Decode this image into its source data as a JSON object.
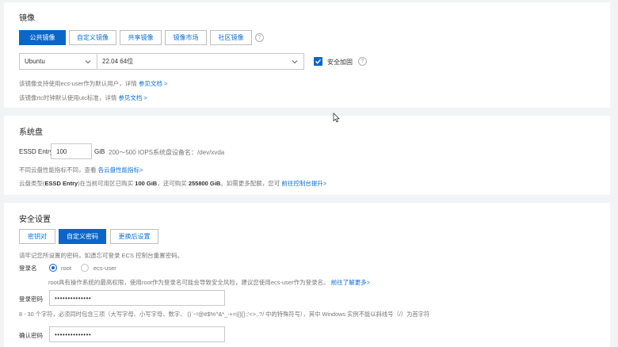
{
  "image": {
    "title": "镜像",
    "tabs": [
      "公共镜像",
      "自定义镜像",
      "共享镜像",
      "镜像市场",
      "社区镜像"
    ],
    "os_select": "Ubuntu",
    "version_select": "22.04 64位",
    "security_label": "安全加固",
    "note1_text": "该镜像支持使用ecs-user作为默认用户，详情",
    "note1_link": "参见文档 >",
    "note2_text": "该镜像rtc时钟默认使用utc标准，详情",
    "note2_link": "参见文档 >"
  },
  "disk": {
    "title": "系统盘",
    "type_label": "ESSD Entry",
    "size_value": "100",
    "unit": "GiB",
    "iops": "200～500 IOPS",
    "device_label": "系统盘设备名：",
    "device_name": "/dev/xvda",
    "note1_text": "不同云盘性能指标不同，查看",
    "note1_link": "各云盘性能指标>",
    "note2_pre": "云盘类型(",
    "note2_b1": "ESSD Entry",
    "note2_mid1": ")在当前可用区已购买",
    "note2_b2": "100 GiB",
    "note2_mid2": "，还可购买",
    "note2_b3": "255800 GiB",
    "note2_mid3": "。如需更多配额，您可",
    "note2_link": "前往控制台提升>"
  },
  "security": {
    "title": "安全设置",
    "tabs": [
      "密钥对",
      "自定义密码",
      "更换后设置"
    ],
    "remember_note": "请牢记您所设置的密码，如遗忘可登录 ECS 控制台重置密码。",
    "login_label": "登录名",
    "radio_root": "root",
    "radio_ecs": "ecs-user",
    "root_note": "root具有操作系统的最高权限，使用root作为登录名可能会导致安全风险，建议您使用ecs-user作为登录名。",
    "root_link": "前往了解更多>",
    "password_label": "登录密码",
    "password_value": "••••••••••••••",
    "rule_note": "8 - 30 个字符，必须同时包含三项（大写字母、小写字母、数字、 ()`~!@#$%^&*_-+=|{}[]:;'<>,.?/ 中的特殊符号），其中 Windows 实例不能以斜线号（/）为首字符",
    "confirm_label": "确认密码",
    "confirm_value": "••••••••••••••"
  },
  "colors": {
    "accent": "#0a66c9",
    "link": "#0a6fd6",
    "background": "#f2f3f5"
  }
}
